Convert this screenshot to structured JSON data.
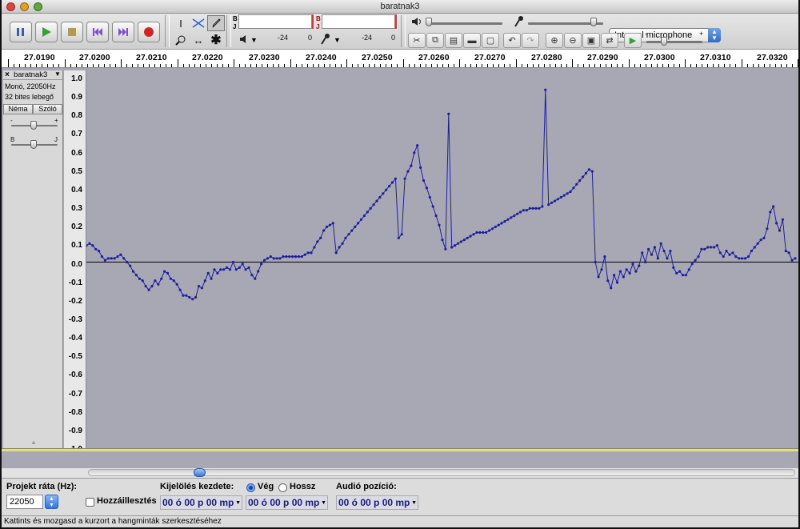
{
  "window": {
    "title": "baratnak3"
  },
  "transport": {
    "pause": "pause-icon",
    "play": "play-icon",
    "stop": "stop-icon",
    "skip_start": "skip-start-icon",
    "skip_end": "skip-end-icon",
    "record": "record-icon"
  },
  "meters": {
    "playback_letters": [
      "B",
      "J"
    ],
    "record_letters": [
      "B",
      "J"
    ],
    "scale_playback": [
      "-24",
      "0"
    ],
    "scale_record": [
      "-24",
      "0"
    ]
  },
  "mixer": {
    "input_device": "Internal microphone",
    "slider_minus": "-",
    "slider_plus": "+"
  },
  "ruler": {
    "labels": [
      "27.0190",
      "27.0200",
      "27.0210",
      "27.0220",
      "27.0230",
      "27.0240",
      "27.0250",
      "27.0260",
      "27.0270",
      "27.0280",
      "27.0290",
      "27.0300",
      "27.0310",
      "27.0320"
    ]
  },
  "track": {
    "name": "baratnak3",
    "format": "Monó, 22050Hz",
    "bits": "32 bites lebegő",
    "mute_label": "Néma",
    "solo_label": "Szóló",
    "gain_minus": "-",
    "gain_plus": "+",
    "pan_left": "B",
    "pan_right": "J"
  },
  "vertical_ruler": [
    "1.0",
    "0.9",
    "0.8",
    "0.7",
    "0.6",
    "0.5",
    "0.4",
    "0.3",
    "0.2",
    "0.1",
    "0.0",
    "-0.1",
    "-0.2",
    "-0.3",
    "-0.4",
    "-0.5",
    "-0.6",
    "-0.7",
    "-0.8",
    "-0.9",
    "-1.0"
  ],
  "chart_data": {
    "type": "line",
    "ylim": [
      -1.0,
      1.0
    ],
    "xlim": [
      27.01875,
      27.03255
    ],
    "line_color": "#1e1ea0",
    "zero_line": true,
    "x_range": [
      27.0189,
      27.0325
    ],
    "values": [
      0.09,
      0.1,
      0.09,
      0.07,
      0.06,
      0.03,
      0.01,
      0.02,
      0.02,
      0.02,
      0.03,
      0.04,
      0.02,
      0.0,
      -0.02,
      -0.05,
      -0.07,
      -0.09,
      -0.1,
      -0.13,
      -0.15,
      -0.13,
      -0.1,
      -0.12,
      -0.09,
      -0.05,
      -0.06,
      -0.09,
      -0.1,
      -0.12,
      -0.15,
      -0.18,
      -0.18,
      -0.19,
      -0.2,
      -0.19,
      -0.13,
      -0.14,
      -0.1,
      -0.06,
      -0.09,
      -0.04,
      -0.06,
      -0.04,
      -0.04,
      -0.03,
      -0.04,
      0.0,
      -0.04,
      -0.03,
      -0.01,
      -0.04,
      -0.03,
      -0.07,
      -0.09,
      -0.05,
      -0.01,
      0.01,
      0.02,
      0.03,
      0.02,
      0.02,
      0.02,
      0.03,
      0.03,
      0.03,
      0.03,
      0.03,
      0.03,
      0.03,
      0.04,
      0.05,
      0.05,
      0.08,
      0.11,
      0.13,
      0.17,
      0.19,
      0.2,
      0.21,
      0.05,
      0.08,
      0.1,
      0.13,
      0.15,
      0.17,
      0.19,
      0.21,
      0.23,
      0.25,
      0.27,
      0.29,
      0.31,
      0.33,
      0.35,
      0.37,
      0.39,
      0.41,
      0.43,
      0.45,
      0.13,
      0.15,
      0.45,
      0.49,
      0.52,
      0.59,
      0.63,
      0.51,
      0.44,
      0.4,
      0.35,
      0.3,
      0.25,
      0.2,
      0.12,
      0.07,
      0.8,
      0.08,
      0.09,
      0.1,
      0.11,
      0.12,
      0.13,
      0.14,
      0.15,
      0.16,
      0.16,
      0.16,
      0.16,
      0.17,
      0.18,
      0.19,
      0.2,
      0.21,
      0.22,
      0.23,
      0.24,
      0.25,
      0.26,
      0.27,
      0.28,
      0.28,
      0.29,
      0.29,
      0.29,
      0.29,
      0.3,
      0.93,
      0.31,
      0.32,
      0.33,
      0.34,
      0.35,
      0.36,
      0.37,
      0.38,
      0.4,
      0.42,
      0.44,
      0.46,
      0.48,
      0.5,
      0.49,
      0.0,
      -0.08,
      -0.04,
      0.03,
      -0.1,
      -0.14,
      -0.07,
      -0.11,
      -0.05,
      -0.08,
      -0.04,
      -0.06,
      -0.01,
      -0.05,
      -0.02,
      0.05,
      0.0,
      0.07,
      0.04,
      0.08,
      0.02,
      0.1,
      0.06,
      0.02,
      0.06,
      -0.03,
      -0.06,
      -0.05,
      -0.07,
      -0.07,
      -0.04,
      -0.01,
      0.01,
      0.03,
      0.07,
      0.07,
      0.08,
      0.08,
      0.08,
      0.09,
      0.05,
      0.03,
      0.06,
      0.04,
      0.05,
      0.03,
      0.02,
      0.02,
      0.02,
      0.03,
      0.06,
      0.08,
      0.1,
      0.12,
      0.13,
      0.18,
      0.27,
      0.3,
      0.21,
      0.17,
      0.23,
      0.06,
      0.05,
      0.01,
      0.02
    ]
  }
}
